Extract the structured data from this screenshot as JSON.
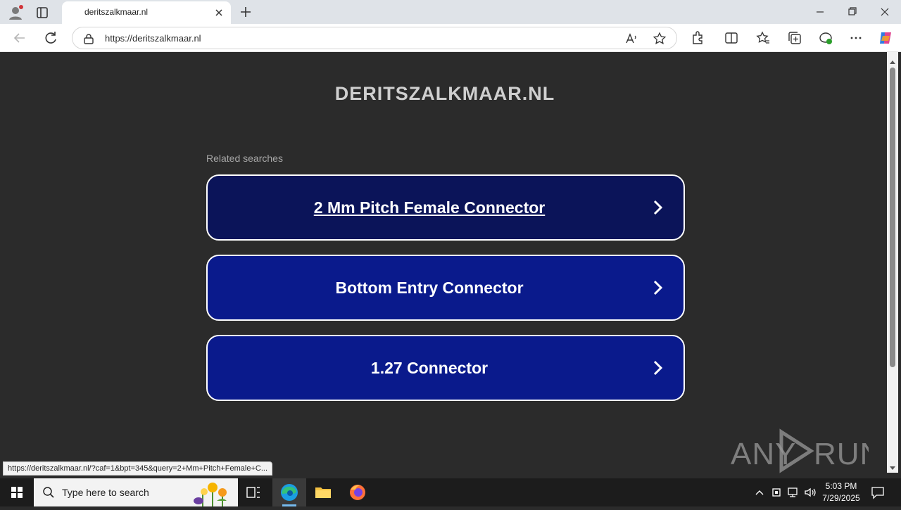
{
  "browser": {
    "tab_title": "deritszalkmaar.nl",
    "url": "https://deritszalkmaar.nl",
    "status_url": "https://deritszalkmaar.nl/?caf=1&bpt=345&query=2+Mm+Pitch+Female+C..."
  },
  "page": {
    "site_title": "DERITSZALKMAAR.NL",
    "related_label": "Related searches",
    "links": [
      {
        "label": "2 Mm Pitch Female Connector"
      },
      {
        "label": "Bottom Entry Connector"
      },
      {
        "label": "1.27 Connector"
      }
    ]
  },
  "watermark": {
    "text": "ANY RUN"
  },
  "taskbar": {
    "search_placeholder": "Type here to search",
    "time": "5:03 PM",
    "date": "7/29/2025"
  },
  "colors": {
    "page_bg": "#2b2b2b",
    "button_primary": "#0a1a8c",
    "button_hover": "#0b1459",
    "title_text": "#cfcfcf"
  }
}
